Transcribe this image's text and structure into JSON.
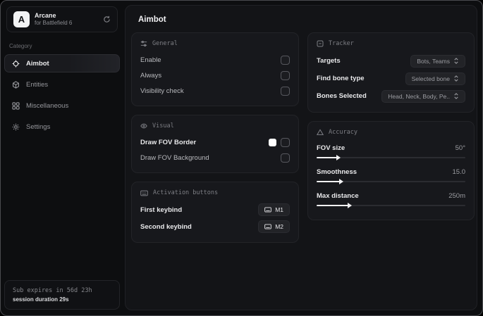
{
  "app": {
    "logo_letter": "A",
    "name": "Arcane",
    "subtitle": "for Battlefield 6"
  },
  "sidebar": {
    "category_label": "Category",
    "items": [
      {
        "label": "Aimbot",
        "icon": "crosshair-icon",
        "active": true
      },
      {
        "label": "Entities",
        "icon": "cube-icon",
        "active": false
      },
      {
        "label": "Miscellaneous",
        "icon": "grid-icon",
        "active": false
      },
      {
        "label": "Settings",
        "icon": "gear-icon",
        "active": false
      }
    ],
    "footer": {
      "sub_expires": "Sub expires in 56d 23h",
      "session_duration": "session duration 29s"
    }
  },
  "main": {
    "title": "Aimbot",
    "general": {
      "title": "General",
      "rows": [
        {
          "label": "Enable",
          "checked": false
        },
        {
          "label": "Always",
          "checked": false
        },
        {
          "label": "Visibility check",
          "checked": false
        }
      ]
    },
    "visual": {
      "title": "Visual",
      "rows": [
        {
          "label": "Draw FOV Border",
          "checked": false,
          "swatch_color": "#ffffff"
        },
        {
          "label": "Draw FOV Background",
          "checked": false
        }
      ]
    },
    "activation": {
      "title": "Activation buttons",
      "rows": [
        {
          "label": "First keybind",
          "key": "M1"
        },
        {
          "label": "Second keybind",
          "key": "M2"
        }
      ]
    },
    "tracker": {
      "title": "Tracker",
      "rows": [
        {
          "label": "Targets",
          "value": "Bots, Teams"
        },
        {
          "label": "Find bone type",
          "value": "Selected bone"
        },
        {
          "label": "Bones Selected",
          "value": "Head, Neck, Body, Pe.."
        }
      ]
    },
    "accuracy": {
      "title": "Accuracy",
      "rows": [
        {
          "label": "FOV size",
          "value": "50°",
          "fill_percent": 14
        },
        {
          "label": "Smoothness",
          "value": "15.0",
          "fill_percent": 16
        },
        {
          "label": "Max distance",
          "value": "250m",
          "fill_percent": 22
        }
      ]
    }
  },
  "colors": {
    "window_bg": "#0d0e10",
    "card_bg": "#17181c",
    "accent_fill": "#f2f2f4",
    "fov_border_swatch": "#ffffff"
  }
}
